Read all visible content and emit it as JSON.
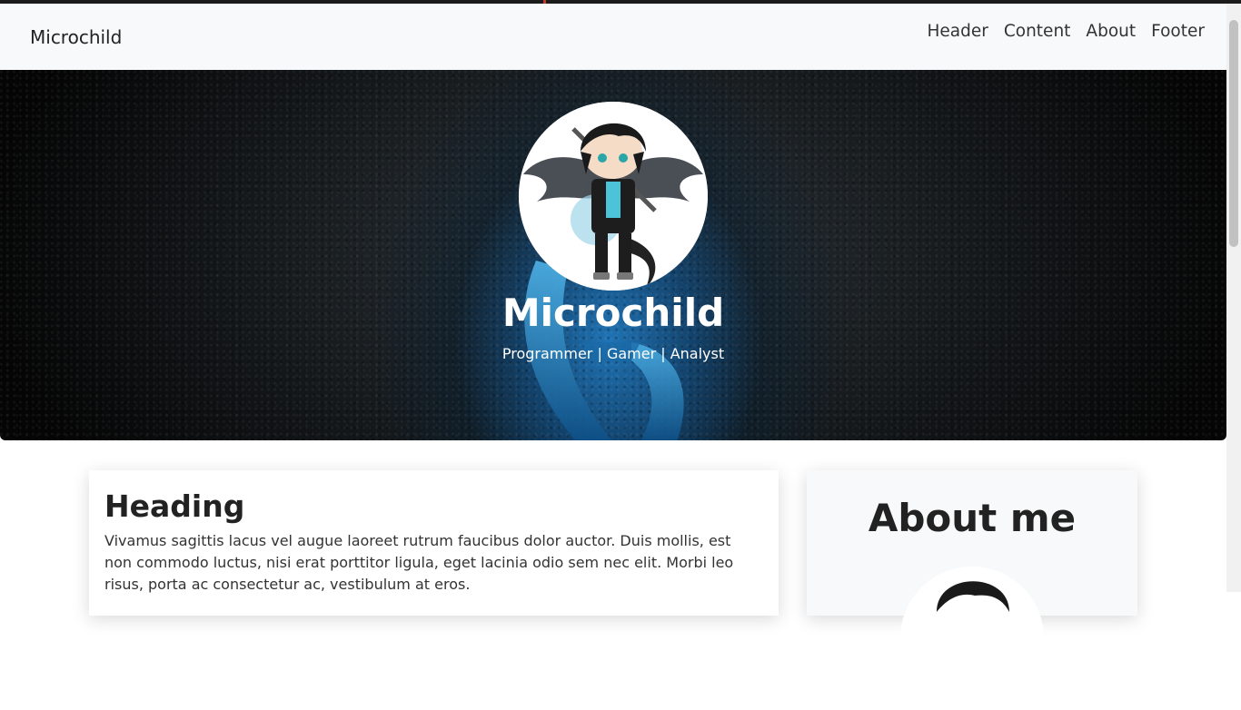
{
  "navbar": {
    "brand": "Microchild",
    "links": [
      "Header",
      "Content",
      "About",
      "Footer"
    ]
  },
  "hero": {
    "title": "Microchild",
    "subtitle": "Programmer | Gamer | Analyst"
  },
  "main_card": {
    "heading": "Heading",
    "body": "Vivamus sagittis lacus vel augue laoreet rutrum faucibus dolor auctor. Duis mollis, est non commodo luctus, nisi erat porttitor ligula, eget lacinia odio sem nec elit. Morbi leo risus, porta ac consectetur ac, vestibulum at eros."
  },
  "about_card": {
    "heading": "About me"
  },
  "colors": {
    "navbar_bg": "#f8f9fa",
    "hero_accent": "#1f78be",
    "text": "#222222"
  }
}
